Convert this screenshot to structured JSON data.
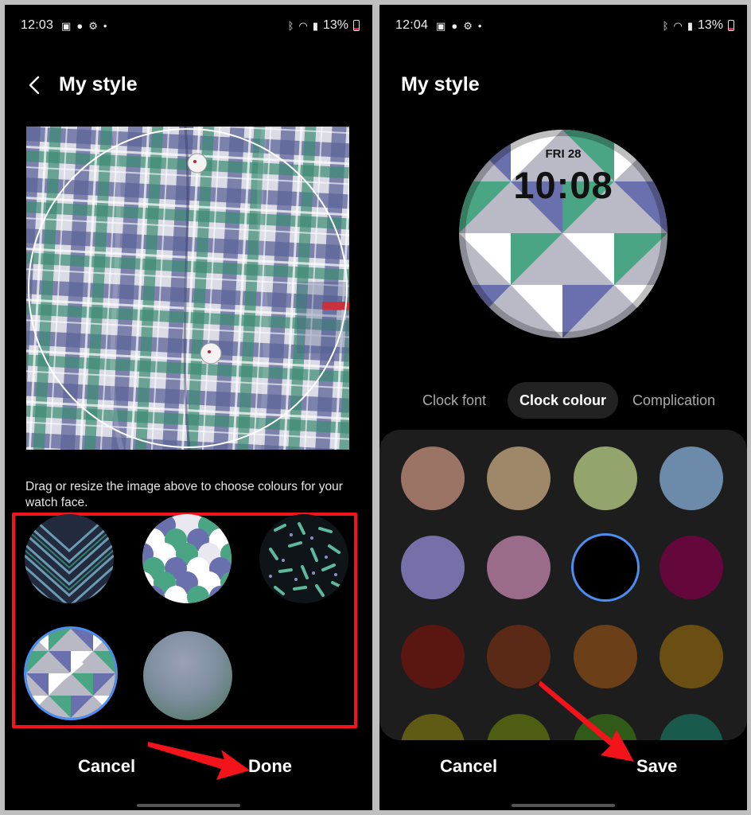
{
  "left_screen": {
    "status": {
      "time": "12:03",
      "battery": "13%"
    },
    "title": "My style",
    "hint": "Drag or resize the image above to choose colours for your watch face.",
    "buttons": {
      "cancel": "Cancel",
      "done": "Done"
    }
  },
  "right_screen": {
    "status": {
      "time": "12:04",
      "battery": "13%"
    },
    "title": "My style",
    "watch": {
      "date": "FRI 28",
      "time": "10:08"
    },
    "tabs": [
      "Clock font",
      "Clock colour",
      "Complication"
    ],
    "active_tab": "Clock colour",
    "colors": [
      "#9c7466",
      "#9f876a",
      "#93a46c",
      "#6c8aa9",
      "#766fa8",
      "#9a6c8a",
      "#000000",
      "#64073b",
      "#5a1611",
      "#5a2a16",
      "#6b3f17",
      "#6b4f12",
      "#5f5a14",
      "#4d5e12",
      "#2f5a18",
      "#1a5a4c"
    ],
    "selected_color_index": 6,
    "buttons": {
      "cancel": "Cancel",
      "save": "Save"
    }
  },
  "annotation_color": "#f2141a",
  "selection_color": "#4c8ef0"
}
